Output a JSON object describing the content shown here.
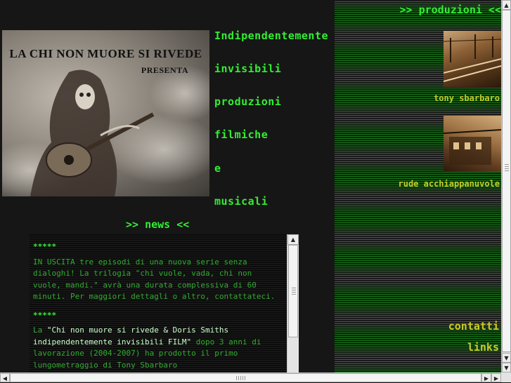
{
  "poster": {
    "title": "LA CHI NON MUORE SI RIVEDE",
    "subtitle": "PRESENTA"
  },
  "tagline": [
    "Indipendentemente",
    "invisibili",
    "produzioni",
    "filmiche",
    "e",
    "musicali"
  ],
  "news": {
    "heading": ">> news <<",
    "items": [
      {
        "stars": "*****",
        "text": "IN USCITA tre episodi di una nuova serie senza dialoghi! La trilogia \"chi vuole, vada, chi non vuole, mandi.\" avrà una durata complessiva di 60 minuti. Per maggiori dettagli o altro, contattateci."
      },
      {
        "stars": "*****",
        "text_pre": "La ",
        "text_hl": "\"Chi non muore si rivede & Doris Smiths indipendentemente invisibili FILM\"",
        "text_post": " dopo 3 anni di lavorazione (2004-2007) ha prodotto il primo lungometraggio di Tony Sbarbaro"
      }
    ]
  },
  "produzioni": {
    "heading": ">> produzioni <<",
    "items": [
      {
        "label": "tony sbarbaro",
        "icon": "train-photo"
      },
      {
        "label": "rude acchiappanuvole",
        "icon": "building-photo"
      }
    ]
  },
  "nav": {
    "contatti": "contatti",
    "links": "links"
  },
  "colors": {
    "bright_green": "#33ee33",
    "text_green": "#33aa33",
    "yellow": "#c9c928",
    "background": "#161616"
  }
}
